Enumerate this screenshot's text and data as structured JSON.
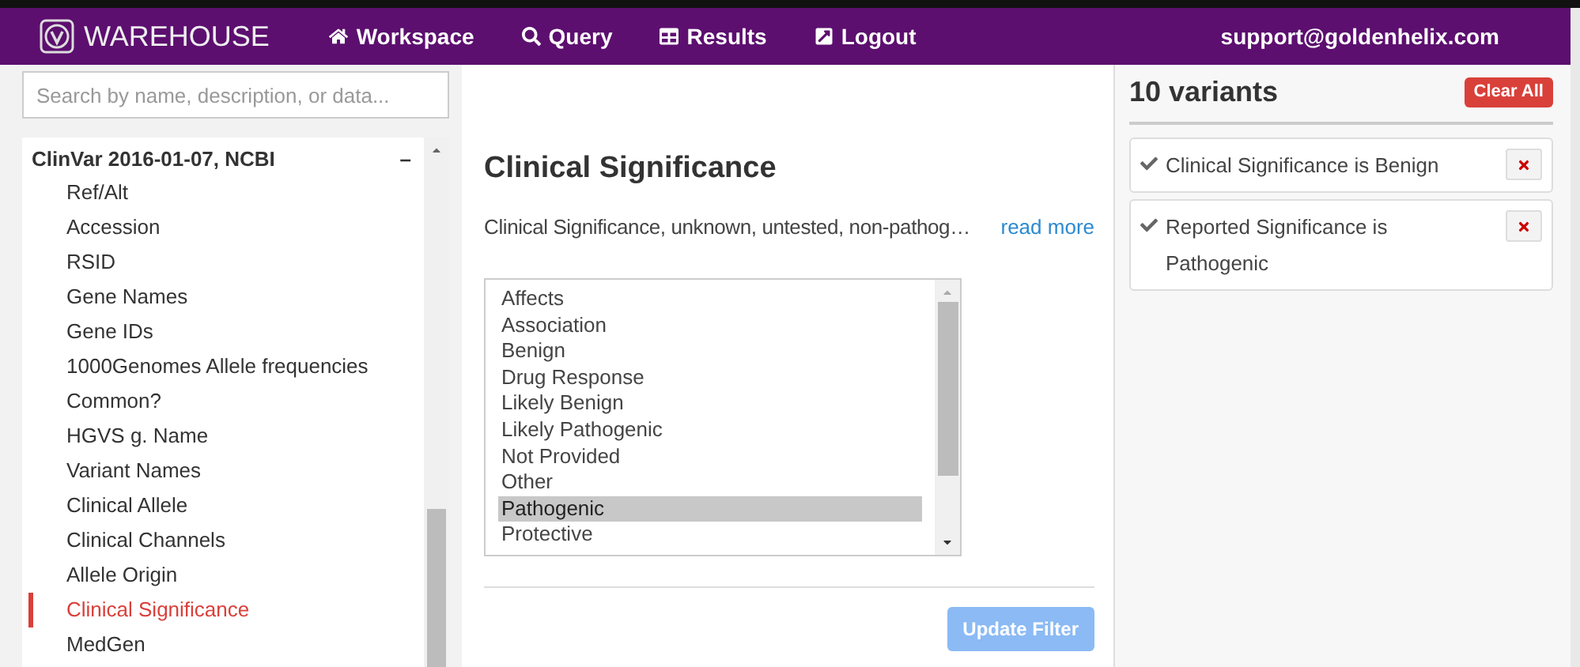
{
  "navbar": {
    "brand": "WAREHOUSE",
    "links": [
      {
        "kind": "home",
        "label": "Workspace"
      },
      {
        "kind": "search",
        "label": "Query"
      },
      {
        "kind": "table",
        "label": "Results"
      },
      {
        "kind": "logout",
        "label": "Logout"
      }
    ],
    "user": "support@goldenhelix.com"
  },
  "sidebar": {
    "search": {
      "placeholder": "Search by name, description, or data..."
    },
    "group": {
      "title": "ClinVar 2016-01-07, NCBI",
      "expanded": true,
      "toggle": "–",
      "items": [
        {
          "label": "Ref/Alt",
          "selected": false
        },
        {
          "label": "Accession",
          "selected": false
        },
        {
          "label": "RSID",
          "selected": false
        },
        {
          "label": "Gene Names",
          "selected": false
        },
        {
          "label": "Gene IDs",
          "selected": false
        },
        {
          "label": "1000Genomes Allele frequencies",
          "selected": false
        },
        {
          "label": "Common?",
          "selected": false
        },
        {
          "label": "HGVS g. Name",
          "selected": false
        },
        {
          "label": "Variant Names",
          "selected": false
        },
        {
          "label": "Clinical Allele",
          "selected": false
        },
        {
          "label": "Clinical Channels",
          "selected": false
        },
        {
          "label": "Allele Origin",
          "selected": false
        },
        {
          "label": "Clinical Significance",
          "selected": true
        },
        {
          "label": "MedGen",
          "selected": false
        }
      ]
    }
  },
  "detail": {
    "title": "Clinical Significance",
    "description": "Clinical Significance, unknown, untested, non-pathog…",
    "read_more": "read more",
    "options": [
      {
        "label": "Affects",
        "selected": false
      },
      {
        "label": "Association",
        "selected": false
      },
      {
        "label": "Benign",
        "selected": false
      },
      {
        "label": "Drug Response",
        "selected": false
      },
      {
        "label": "Likely Benign",
        "selected": false
      },
      {
        "label": "Likely Pathogenic",
        "selected": false
      },
      {
        "label": "Not Provided",
        "selected": false
      },
      {
        "label": "Other",
        "selected": false
      },
      {
        "label": "Pathogenic",
        "selected": true
      },
      {
        "label": "Protective",
        "selected": false
      }
    ],
    "button": {
      "label": "Update Filter",
      "disabled": true
    }
  },
  "filters": {
    "count": "10 variants",
    "clear": "Clear All",
    "items": [
      {
        "label": "Clinical Significance is Benign",
        "checked": true
      },
      {
        "label": "Reported Significance is Pathogenic",
        "checked": true
      }
    ]
  }
}
